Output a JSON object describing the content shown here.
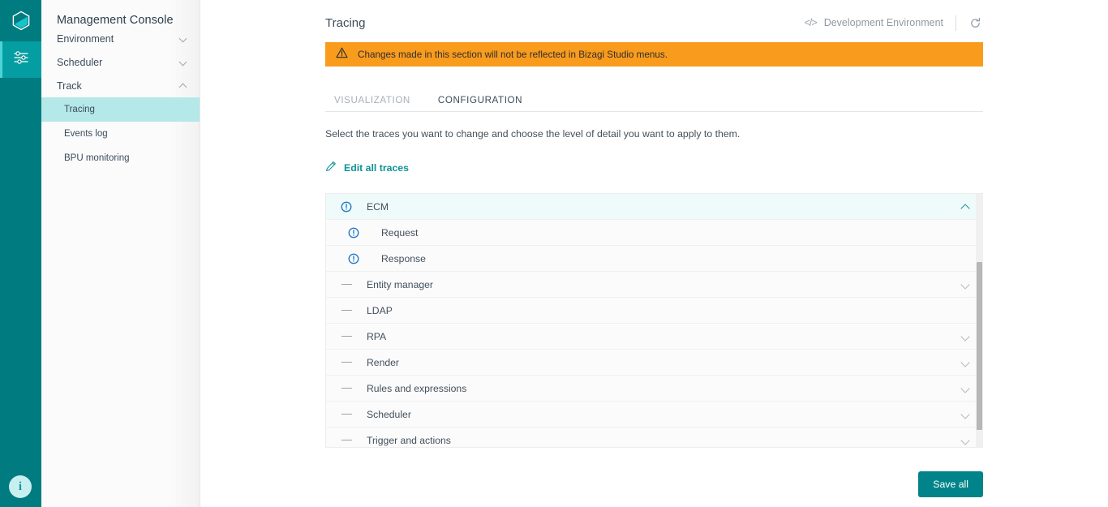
{
  "rail": {
    "logo_name": "hexagon-logo",
    "items": [
      {
        "name": "settings-sliders",
        "active": true
      }
    ],
    "help_label": "i"
  },
  "sidebar": {
    "title": "Management Console",
    "groups": [
      {
        "label": "Environment",
        "expanded": false
      },
      {
        "label": "Scheduler",
        "expanded": false
      },
      {
        "label": "Track",
        "expanded": true
      }
    ],
    "track_items": [
      {
        "label": "Tracing",
        "active": true
      },
      {
        "label": "Events log",
        "active": false
      },
      {
        "label": "BPU monitoring",
        "active": false
      }
    ]
  },
  "header": {
    "title": "Tracing",
    "environment": "Development Environment",
    "code_icon": "</>",
    "refresh_icon": "refresh-icon"
  },
  "banner": {
    "icon": "warning-triangle-icon",
    "text": "Changes made in this section will not be reflected in Bizagi Studio menus."
  },
  "tabs": [
    {
      "label": "VISUALIZATION",
      "active": false
    },
    {
      "label": "CONFIGURATION",
      "active": true
    }
  ],
  "description": "Select the traces you want to change and choose the level of detail you want to apply to them.",
  "edit_all": {
    "label": "Edit all traces",
    "icon": "pencil-icon"
  },
  "traces": [
    {
      "label": "ECM",
      "marker": "info",
      "level": 0,
      "chevron": "up",
      "selected": true
    },
    {
      "label": "Request",
      "marker": "info",
      "level": 1,
      "chevron": "none",
      "selected": false
    },
    {
      "label": "Response",
      "marker": "info",
      "level": 1,
      "chevron": "none",
      "selected": false
    },
    {
      "label": "Entity manager",
      "marker": "dash",
      "level": 0,
      "chevron": "down",
      "selected": false
    },
    {
      "label": "LDAP",
      "marker": "dash",
      "level": 0,
      "chevron": "none",
      "selected": false
    },
    {
      "label": "RPA",
      "marker": "dash",
      "level": 0,
      "chevron": "down",
      "selected": false
    },
    {
      "label": "Render",
      "marker": "dash",
      "level": 0,
      "chevron": "down",
      "selected": false
    },
    {
      "label": "Rules and expressions",
      "marker": "dash",
      "level": 0,
      "chevron": "down",
      "selected": false
    },
    {
      "label": "Scheduler",
      "marker": "dash",
      "level": 0,
      "chevron": "down",
      "selected": false
    },
    {
      "label": "Trigger and actions",
      "marker": "dash",
      "level": 0,
      "chevron": "down",
      "selected": false
    }
  ],
  "footer": {
    "save_label": "Save all"
  },
  "colors": {
    "brand_teal": "#007b80",
    "accent_teal": "#008489",
    "sidebar_active": "#b5e8e8",
    "row_selected": "#effafa",
    "warning_orange": "#f99b1c",
    "info_blue": "#1a73c8"
  }
}
